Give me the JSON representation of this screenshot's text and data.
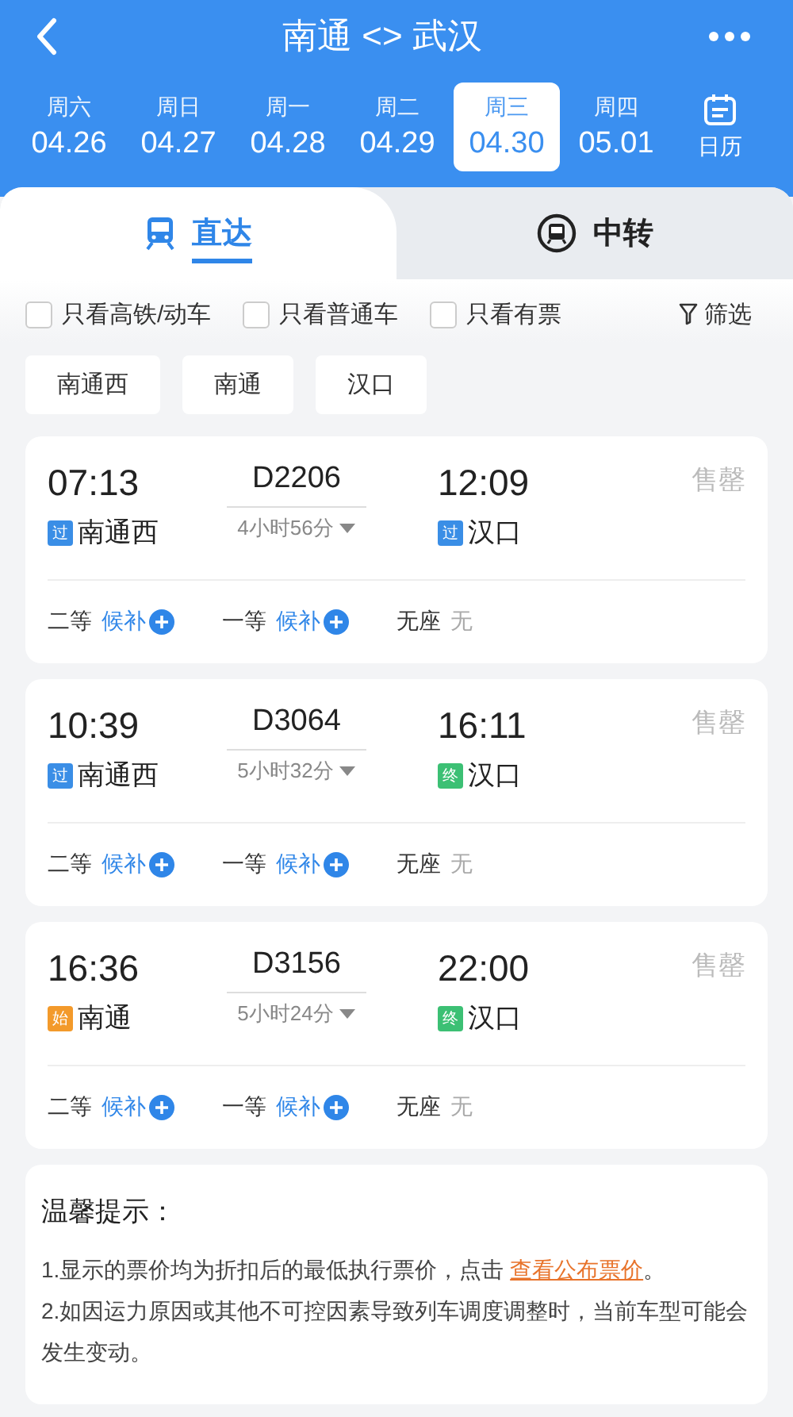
{
  "header": {
    "title": "南通 <> 武汉"
  },
  "dates": [
    {
      "weekday": "周六",
      "date": "04.26",
      "selected": false
    },
    {
      "weekday": "周日",
      "date": "04.27",
      "selected": false
    },
    {
      "weekday": "周一",
      "date": "04.28",
      "selected": false
    },
    {
      "weekday": "周二",
      "date": "04.29",
      "selected": false
    },
    {
      "weekday": "周三",
      "date": "04.30",
      "selected": true
    },
    {
      "weekday": "周四",
      "date": "05.01",
      "selected": false
    }
  ],
  "calendar_label": "日历",
  "tabs": [
    {
      "label": "直达",
      "kind": "direct",
      "selected": true
    },
    {
      "label": "中转",
      "kind": "transfer",
      "selected": false
    }
  ],
  "filters": [
    {
      "label": "只看高铁/动车",
      "checked": false
    },
    {
      "label": "只看普通车",
      "checked": false
    },
    {
      "label": "只看有票",
      "checked": false
    }
  ],
  "filter_button": "筛选",
  "stations": [
    "南通西",
    "南通",
    "汉口"
  ],
  "trains": [
    {
      "depart_time": "07:13",
      "depart_station": "南通西",
      "depart_badge": {
        "text": "过",
        "color": "#3a8ee6"
      },
      "train_no": "D2206",
      "duration": "4小时56分",
      "arrive_time": "12:09",
      "arrive_station": "汉口",
      "arrive_badge": {
        "text": "过",
        "color": "#3a8ee6"
      },
      "status": "售罄",
      "seats": [
        {
          "class": "二等",
          "status": "候补",
          "kind": "waitlist"
        },
        {
          "class": "一等",
          "status": "候补",
          "kind": "waitlist"
        },
        {
          "class": "无座",
          "status": "无",
          "kind": "none"
        }
      ]
    },
    {
      "depart_time": "10:39",
      "depart_station": "南通西",
      "depart_badge": {
        "text": "过",
        "color": "#3a8ee6"
      },
      "train_no": "D3064",
      "duration": "5小时32分",
      "arrive_time": "16:11",
      "arrive_station": "汉口",
      "arrive_badge": {
        "text": "终",
        "color": "#3cc074"
      },
      "status": "售罄",
      "seats": [
        {
          "class": "二等",
          "status": "候补",
          "kind": "waitlist"
        },
        {
          "class": "一等",
          "status": "候补",
          "kind": "waitlist"
        },
        {
          "class": "无座",
          "status": "无",
          "kind": "none"
        }
      ]
    },
    {
      "depart_time": "16:36",
      "depart_station": "南通",
      "depart_badge": {
        "text": "始",
        "color": "#f39a2b"
      },
      "train_no": "D3156",
      "duration": "5小时24分",
      "arrive_time": "22:00",
      "arrive_station": "汉口",
      "arrive_badge": {
        "text": "终",
        "color": "#3cc074"
      },
      "status": "售罄",
      "seats": [
        {
          "class": "二等",
          "status": "候补",
          "kind": "waitlist"
        },
        {
          "class": "一等",
          "status": "候补",
          "kind": "waitlist"
        },
        {
          "class": "无座",
          "status": "无",
          "kind": "none"
        }
      ]
    }
  ],
  "notice": {
    "title": "温馨提示：",
    "items": [
      {
        "text": "1.显示的票价均为折扣后的最低执行票价，点击 ",
        "link": "查看公布票价",
        "after": "。"
      },
      {
        "text": "2.如因运力原因或其他不可控因素导致列车调度调整时，当前车型可能会发生变动。"
      }
    ]
  }
}
